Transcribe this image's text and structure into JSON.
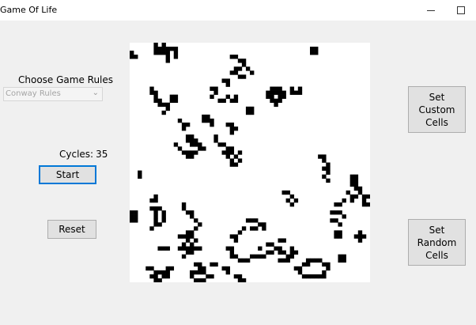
{
  "window": {
    "title": "Game Of Life",
    "minimize_icon": "minimize-icon",
    "maximize_icon": "maximize-icon"
  },
  "rules": {
    "label": "Choose Game Rules",
    "selected": "Conway Rules"
  },
  "cycles": {
    "label": "Cycles:",
    "value": "35"
  },
  "buttons": {
    "start": "Start",
    "reset": "Reset",
    "set_custom": "Set\nCustom\nCells",
    "set_random": "Set\nRandom\nCells"
  },
  "grid": {
    "cols": 60,
    "rows": 60,
    "alive_color": "#000000",
    "dead_color": "#ffffff",
    "live_cells": [
      [
        0,
        2
      ],
      [
        0,
        3
      ],
      [
        1,
        3
      ],
      [
        6,
        0
      ],
      [
        6,
        1
      ],
      [
        6,
        2
      ],
      [
        7,
        1
      ],
      [
        7,
        2
      ],
      [
        8,
        1
      ],
      [
        8,
        2
      ],
      [
        9,
        1
      ],
      [
        9,
        2
      ],
      [
        9,
        3
      ],
      [
        9,
        4
      ],
      [
        10,
        1
      ],
      [
        11,
        1
      ],
      [
        11,
        2
      ],
      [
        11,
        3
      ],
      [
        8,
        0
      ],
      [
        45,
        1
      ],
      [
        45,
        2
      ],
      [
        46,
        1
      ],
      [
        46,
        2
      ],
      [
        25,
        3
      ],
      [
        26,
        3
      ],
      [
        27,
        4
      ],
      [
        28,
        4
      ],
      [
        28,
        5
      ],
      [
        27,
        6
      ],
      [
        26,
        6
      ],
      [
        25,
        7
      ],
      [
        26,
        7
      ],
      [
        27,
        8
      ],
      [
        28,
        8
      ],
      [
        29,
        6
      ],
      [
        30,
        7
      ],
      [
        5,
        11
      ],
      [
        5,
        12
      ],
      [
        6,
        12
      ],
      [
        6,
        13
      ],
      [
        6,
        14
      ],
      [
        7,
        14
      ],
      [
        7,
        15
      ],
      [
        8,
        15
      ],
      [
        9,
        15
      ],
      [
        9,
        16
      ],
      [
        8,
        17
      ],
      [
        10,
        14
      ],
      [
        11,
        14
      ],
      [
        10,
        13
      ],
      [
        11,
        13
      ],
      [
        20,
        11
      ],
      [
        21,
        11
      ],
      [
        21,
        12
      ],
      [
        20,
        13
      ],
      [
        22,
        14
      ],
      [
        23,
        14
      ],
      [
        24,
        13
      ],
      [
        25,
        14
      ],
      [
        26,
        14
      ],
      [
        26,
        13
      ],
      [
        23,
        9
      ],
      [
        24,
        9
      ],
      [
        24,
        10
      ],
      [
        34,
        12
      ],
      [
        34,
        13
      ],
      [
        35,
        11
      ],
      [
        35,
        12
      ],
      [
        35,
        13
      ],
      [
        35,
        14
      ],
      [
        36,
        11
      ],
      [
        36,
        12
      ],
      [
        36,
        14
      ],
      [
        37,
        11
      ],
      [
        37,
        12
      ],
      [
        37,
        13
      ],
      [
        37,
        14
      ],
      [
        38,
        12
      ],
      [
        38,
        13
      ],
      [
        36,
        15
      ],
      [
        40,
        11
      ],
      [
        40,
        12
      ],
      [
        41,
        12
      ],
      [
        42,
        11
      ],
      [
        42,
        12
      ],
      [
        29,
        16
      ],
      [
        30,
        16
      ],
      [
        29,
        17
      ],
      [
        30,
        17
      ],
      [
        18,
        18
      ],
      [
        19,
        18
      ],
      [
        18,
        19
      ],
      [
        19,
        19
      ],
      [
        20,
        19
      ],
      [
        20,
        20
      ],
      [
        24,
        20
      ],
      [
        25,
        20
      ],
      [
        25,
        21
      ],
      [
        26,
        21
      ],
      [
        25,
        22
      ],
      [
        12,
        19
      ],
      [
        13,
        20
      ],
      [
        14,
        20
      ],
      [
        13,
        21
      ],
      [
        14,
        23
      ],
      [
        15,
        23
      ],
      [
        14,
        24
      ],
      [
        15,
        24
      ],
      [
        16,
        24
      ],
      [
        15,
        25
      ],
      [
        16,
        25
      ],
      [
        17,
        25
      ],
      [
        18,
        26
      ],
      [
        17,
        26
      ],
      [
        16,
        27
      ],
      [
        15,
        27
      ],
      [
        14,
        27
      ],
      [
        13,
        27
      ],
      [
        14,
        28
      ],
      [
        15,
        28
      ],
      [
        12,
        26
      ],
      [
        11,
        25
      ],
      [
        21,
        23
      ],
      [
        21,
        24
      ],
      [
        22,
        25
      ],
      [
        23,
        25
      ],
      [
        24,
        26
      ],
      [
        25,
        26
      ],
      [
        24,
        27
      ],
      [
        25,
        27
      ],
      [
        26,
        28
      ],
      [
        27,
        29
      ],
      [
        25,
        29
      ],
      [
        25,
        30
      ],
      [
        26,
        30
      ],
      [
        24,
        28
      ],
      [
        27,
        27
      ],
      [
        23,
        27
      ],
      [
        47,
        28
      ],
      [
        48,
        28
      ],
      [
        48,
        29
      ],
      [
        49,
        30
      ],
      [
        48,
        31
      ],
      [
        49,
        31
      ],
      [
        49,
        32
      ],
      [
        48,
        33
      ],
      [
        49,
        34
      ],
      [
        55,
        33
      ],
      [
        56,
        33
      ],
      [
        55,
        34
      ],
      [
        56,
        34
      ],
      [
        55,
        35
      ],
      [
        56,
        35
      ],
      [
        56,
        36
      ],
      [
        57,
        36
      ],
      [
        57,
        37
      ],
      [
        54,
        37
      ],
      [
        55,
        38
      ],
      [
        55,
        39
      ],
      [
        56,
        38
      ],
      [
        58,
        38
      ],
      [
        59,
        38
      ],
      [
        58,
        39
      ],
      [
        58,
        40
      ],
      [
        59,
        40
      ],
      [
        53,
        39
      ],
      [
        52,
        40
      ],
      [
        51,
        40
      ],
      [
        38,
        37
      ],
      [
        39,
        37
      ],
      [
        40,
        38
      ],
      [
        41,
        39
      ],
      [
        40,
        40
      ],
      [
        39,
        39
      ],
      [
        2,
        32
      ],
      [
        2,
        33
      ],
      [
        0,
        42
      ],
      [
        1,
        42
      ],
      [
        0,
        43
      ],
      [
        1,
        43
      ],
      [
        0,
        44
      ],
      [
        1,
        44
      ],
      [
        5,
        39
      ],
      [
        6,
        38
      ],
      [
        6,
        39
      ],
      [
        5,
        41
      ],
      [
        6,
        41
      ],
      [
        7,
        41
      ],
      [
        6,
        42
      ],
      [
        6,
        43
      ],
      [
        6,
        44
      ],
      [
        7,
        45
      ],
      [
        6,
        45
      ],
      [
        5,
        46
      ],
      [
        8,
        42
      ],
      [
        8,
        43
      ],
      [
        8,
        44
      ],
      [
        13,
        40
      ],
      [
        13,
        41
      ],
      [
        14,
        42
      ],
      [
        15,
        42
      ],
      [
        15,
        43
      ],
      [
        16,
        44
      ],
      [
        17,
        45
      ],
      [
        16,
        46
      ],
      [
        50,
        42
      ],
      [
        51,
        42
      ],
      [
        52,
        42
      ],
      [
        50,
        44
      ],
      [
        51,
        44
      ],
      [
        53,
        43
      ],
      [
        52,
        45
      ],
      [
        57,
        47
      ],
      [
        56,
        48
      ],
      [
        57,
        48
      ],
      [
        58,
        48
      ],
      [
        57,
        49
      ],
      [
        51,
        47
      ],
      [
        52,
        47
      ],
      [
        51,
        48
      ],
      [
        52,
        48
      ],
      [
        29,
        44
      ],
      [
        30,
        44
      ],
      [
        31,
        44
      ],
      [
        32,
        45
      ],
      [
        33,
        45
      ],
      [
        33,
        46
      ],
      [
        31,
        46
      ],
      [
        30,
        46
      ],
      [
        28,
        46
      ],
      [
        27,
        47
      ],
      [
        26,
        48
      ],
      [
        25,
        48
      ],
      [
        26,
        49
      ],
      [
        12,
        48
      ],
      [
        13,
        48
      ],
      [
        14,
        48
      ],
      [
        15,
        48
      ],
      [
        14,
        49
      ],
      [
        13,
        50
      ],
      [
        12,
        51
      ],
      [
        13,
        51
      ],
      [
        14,
        51
      ],
      [
        15,
        51
      ],
      [
        16,
        51
      ],
      [
        17,
        51
      ],
      [
        7,
        51
      ],
      [
        8,
        51
      ],
      [
        9,
        51
      ],
      [
        14,
        52
      ],
      [
        15,
        52
      ],
      [
        13,
        53
      ],
      [
        16,
        49
      ],
      [
        15,
        50
      ],
      [
        14,
        47
      ],
      [
        15,
        47
      ],
      [
        24,
        51
      ],
      [
        25,
        51
      ],
      [
        25,
        52
      ],
      [
        26,
        53
      ],
      [
        25,
        53
      ],
      [
        27,
        54
      ],
      [
        34,
        50
      ],
      [
        35,
        50
      ],
      [
        36,
        51
      ],
      [
        37,
        51
      ],
      [
        35,
        52
      ],
      [
        34,
        52
      ],
      [
        33,
        53
      ],
      [
        32,
        53
      ],
      [
        31,
        53
      ],
      [
        30,
        53
      ],
      [
        29,
        54
      ],
      [
        28,
        54
      ],
      [
        32,
        51
      ],
      [
        37,
        49
      ],
      [
        38,
        49
      ],
      [
        37,
        52
      ],
      [
        38,
        52
      ],
      [
        40,
        51
      ],
      [
        41,
        52
      ],
      [
        40,
        52
      ],
      [
        39,
        53
      ],
      [
        40,
        53
      ],
      [
        39,
        54
      ],
      [
        38,
        54
      ],
      [
        37,
        54
      ],
      [
        44,
        54
      ],
      [
        45,
        54
      ],
      [
        46,
        54
      ],
      [
        47,
        54
      ],
      [
        48,
        55
      ],
      [
        49,
        55
      ],
      [
        49,
        56
      ],
      [
        48,
        57
      ],
      [
        48,
        58
      ],
      [
        47,
        58
      ],
      [
        46,
        58
      ],
      [
        45,
        58
      ],
      [
        44,
        58
      ],
      [
        43,
        58
      ],
      [
        42,
        57
      ],
      [
        42,
        56
      ],
      [
        41,
        56
      ],
      [
        43,
        55
      ],
      [
        44,
        55
      ],
      [
        52,
        53
      ],
      [
        53,
        53
      ],
      [
        52,
        54
      ],
      [
        53,
        54
      ],
      [
        4,
        56
      ],
      [
        5,
        56
      ],
      [
        6,
        57
      ],
      [
        7,
        57
      ],
      [
        8,
        57
      ],
      [
        9,
        57
      ],
      [
        10,
        56
      ],
      [
        9,
        56
      ],
      [
        5,
        58
      ],
      [
        6,
        58
      ],
      [
        8,
        58
      ],
      [
        9,
        58
      ],
      [
        6,
        59
      ],
      [
        7,
        59
      ],
      [
        15,
        57
      ],
      [
        16,
        57
      ],
      [
        17,
        56
      ],
      [
        18,
        56
      ],
      [
        17,
        57
      ],
      [
        18,
        57
      ],
      [
        19,
        58
      ],
      [
        20,
        58
      ],
      [
        18,
        59
      ],
      [
        17,
        59
      ],
      [
        16,
        59
      ],
      [
        15,
        58
      ],
      [
        16,
        55
      ],
      [
        17,
        55
      ],
      [
        20,
        55
      ],
      [
        21,
        55
      ],
      [
        23,
        56
      ],
      [
        24,
        56
      ],
      [
        24,
        57
      ],
      [
        26,
        58
      ],
      [
        27,
        58
      ],
      [
        27,
        59
      ],
      [
        28,
        59
      ]
    ]
  }
}
